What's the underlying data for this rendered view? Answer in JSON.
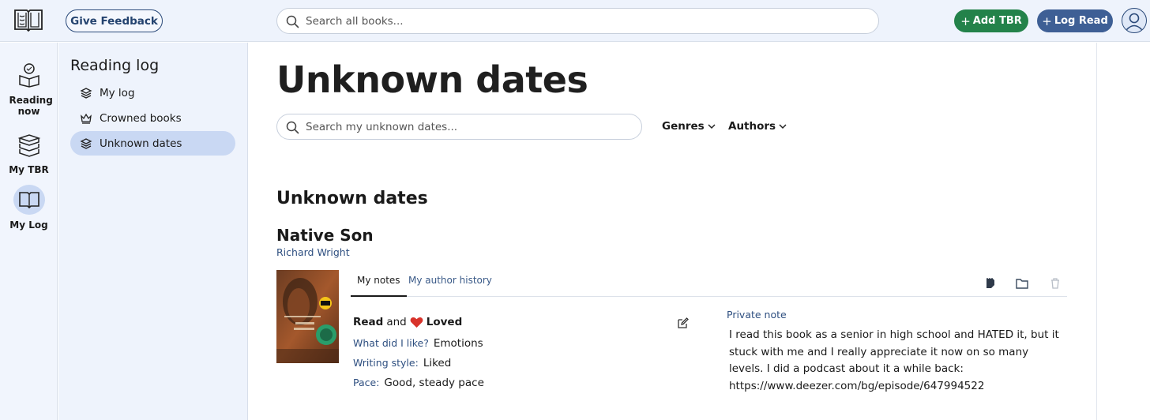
{
  "header": {
    "feedback_label": "Give Feedback",
    "search_placeholder": "Search all books...",
    "add_tbr_label": "Add TBR",
    "log_read_label": "Log Read"
  },
  "rail": {
    "items": [
      {
        "label": "Reading now",
        "icon": "person-reading-icon"
      },
      {
        "label": "My TBR",
        "icon": "book-stack-icon"
      },
      {
        "label": "My Log",
        "icon": "open-book-icon",
        "active": true
      }
    ]
  },
  "sidebar": {
    "title": "Reading log",
    "items": [
      {
        "label": "My log",
        "icon": "layers-icon"
      },
      {
        "label": "Crowned books",
        "icon": "crown-icon"
      },
      {
        "label": "Unknown dates",
        "icon": "layers-icon",
        "active": true
      }
    ]
  },
  "main": {
    "page_title": "Unknown dates",
    "search_placeholder": "Search my unknown dates...",
    "filters": [
      "Genres",
      "Authors"
    ],
    "section_title": "Unknown dates",
    "book": {
      "title": "Native Son",
      "author": "Richard Wright",
      "tabs": [
        "My notes",
        "My author history"
      ],
      "status_read": "Read",
      "status_and": "and",
      "status_loved": "Loved",
      "liked_key": "What did I like?",
      "liked_value": "Emotions",
      "style_key": "Writing style:",
      "style_value": "Liked",
      "pace_key": "Pace:",
      "pace_value": "Good, steady pace",
      "note_label": "Private note",
      "note_text": "I read this book as a senior in high school and HATED it, but it stuck with me and I really appreciate it now on so many levels. I did a podcast about it a while back: https://www.deezer.com/bg/episode/647994522"
    }
  },
  "colors": {
    "add_green": "#23824a",
    "log_blue": "#3e5f95",
    "active_pill": "#c9d8f3",
    "heart": "#d8332b"
  }
}
